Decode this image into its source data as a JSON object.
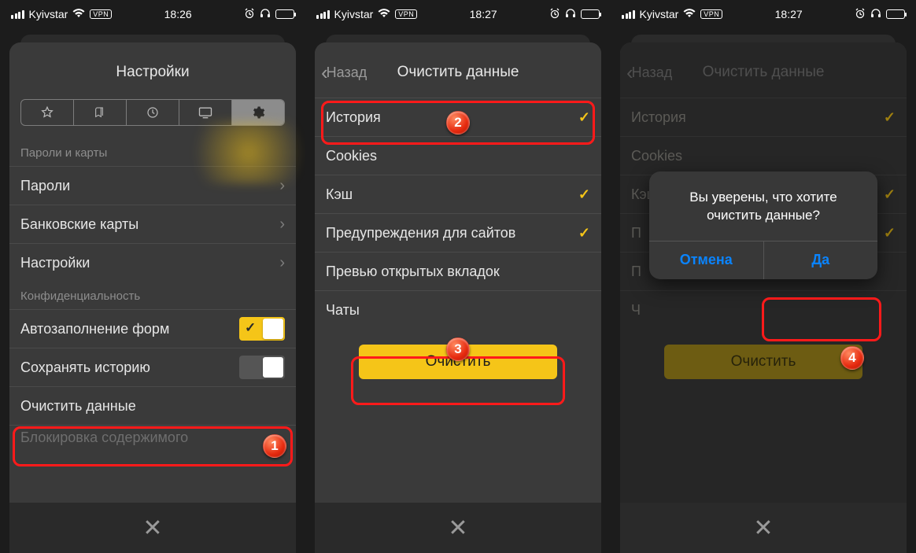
{
  "status": {
    "carrier": "Kyivstar",
    "vpn": "VPN",
    "time1": "18:26",
    "time2": "18:27",
    "time3": "18:27"
  },
  "screen1": {
    "title": "Настройки",
    "section1": "Пароли и карты",
    "rows1": [
      "Пароли",
      "Банковские карты",
      "Настройки"
    ],
    "section2": "Конфиденциальность",
    "autofill": "Автозаполнение форм",
    "history": "Сохранять историю",
    "clearData": "Очистить данные",
    "faded": "Блокировка содержимого"
  },
  "screen2": {
    "back": "Назад",
    "title": "Очистить данные",
    "items": [
      {
        "label": "История",
        "checked": true
      },
      {
        "label": "Cookies",
        "checked": false
      },
      {
        "label": "Кэш",
        "checked": true
      },
      {
        "label": "Предупреждения для сайтов",
        "checked": true
      },
      {
        "label": "Превью открытых вкладок",
        "checked": false
      },
      {
        "label": "Чаты",
        "checked": false
      }
    ],
    "clearBtn": "Очистить"
  },
  "screen3": {
    "back": "Назад",
    "title": "Очистить данные",
    "items": [
      {
        "label": "История",
        "checked": true
      },
      {
        "label": "Cookies",
        "checked": false
      },
      {
        "label": "Кэш",
        "checked": true
      },
      {
        "label": "П",
        "checked": true
      },
      {
        "label": "П",
        "checked": false
      },
      {
        "label": "Ч",
        "checked": false
      }
    ],
    "clearBtn": "Очистить",
    "dialog": {
      "text": "Вы уверены, что хотите очистить данные?",
      "cancel": "Отмена",
      "yes": "Да"
    }
  },
  "badges": {
    "b1": "1",
    "b2": "2",
    "b3": "3",
    "b4": "4"
  }
}
